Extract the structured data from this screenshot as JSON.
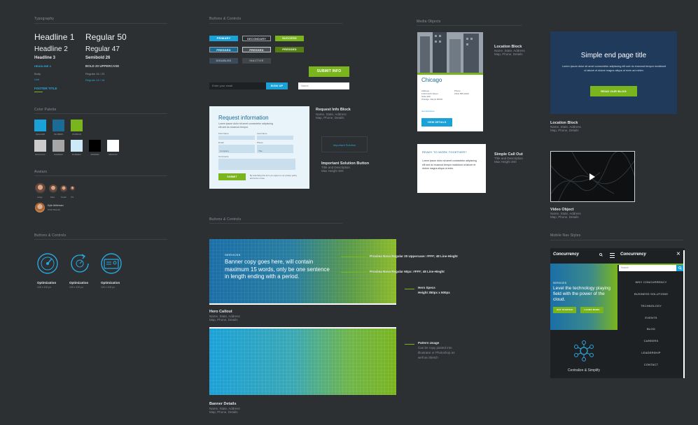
{
  "typography": {
    "section": "Typography",
    "h1": "Headline 1",
    "h2": "Headline 2",
    "h3": "Headline 3",
    "h4": "HEADLINE 4",
    "body": "Body",
    "link": "Link",
    "footer": "FOOTER TITLE",
    "r50": "Regular 50",
    "r47": "Regular 47",
    "sb26": "Semibold 26",
    "bold20": "BOLD 20 UPPERCASE",
    "r16": "Regular 16 / 20",
    "r14": "Regular 14 / 18"
  },
  "palette": {
    "section": "Color Palette",
    "row1": [
      {
        "hex": "#1aa1d8",
        "label": "#1AA1D8"
      },
      {
        "hex": "#1c6b95",
        "label": "#1C6B95"
      },
      {
        "hex": "#7ab51d",
        "label": "#7AB51D"
      }
    ],
    "row2": [
      {
        "hex": "#cccccc",
        "label": "#CCCCCC"
      },
      {
        "hex": "#a6a6a6",
        "label": "#A6A6A6"
      },
      {
        "hex": "#cde8f7",
        "label": "#CDE8F7"
      },
      {
        "hex": "#000000",
        "label": "#000000"
      },
      {
        "hex": "#ffffff",
        "label": "#FFFFFF"
      }
    ]
  },
  "avatars": {
    "section": "Avatars",
    "labels": [
      "Large",
      "Med",
      "Small",
      "XS"
    ],
    "name": "Kyle Abbeman",
    "role": "Chief Director"
  },
  "icons": {
    "section": "Buttons & Controls",
    "items": [
      {
        "name": "Optimization",
        "size": "100 x 100 px"
      },
      {
        "name": "Optimization",
        "size": "100 x 100 px"
      },
      {
        "name": "Optimization",
        "size": "100 x 100 px"
      }
    ]
  },
  "controls": {
    "section": "Buttons & Controls",
    "primary": "PRIMARY",
    "secondary": "SECONDARY",
    "success": "SUCCESS",
    "pressed1": "PRESSED",
    "pressed2": "PRESSED",
    "pressed3": "PRESSED",
    "disabled": "DISABLED",
    "inactive": "INACTIVE",
    "submit": "SUBMIT INFO",
    "search_placeholder": "Enter your email",
    "search_btn": "SIGN UP",
    "text_placeholder": "Name"
  },
  "request": {
    "title": "Request information",
    "text": "Lorem ipsum dolor sit amet consectetur adipiscing elit sed do eiusmod tempor.",
    "fields": [
      "First Name",
      "Last Name",
      "Email",
      "Phone",
      "Company",
      "Title"
    ],
    "comment": "Comments",
    "submit": "SUBMIT",
    "fine": "By submitting this form you agree to our privacy policy and terms of use.",
    "label": "Request Info Block",
    "desc1": "Name, State, Address",
    "desc2": "Map, Phone, Details"
  },
  "solution": {
    "button": "Important Solution",
    "label": "Important Solution Button",
    "desc1": "Title and Description",
    "desc2": "Max Height 300"
  },
  "media": {
    "section": "Media Objects",
    "city": "Chicago",
    "addr_l": [
      "Address",
      "1234 North Street",
      "Suite 200",
      "Chicago, Illinois 60601"
    ],
    "addr_r": [
      "Phone",
      "(312) 555-0100"
    ],
    "link": "Get directions",
    "btn": "VIEW DETAILS",
    "loc_label": "Location Block",
    "loc_desc1": "Name, State, Address",
    "loc_desc2": "Map, Phone, Details",
    "callout_title": "READY TO WORK TOGETHER?",
    "callout_text": "Lorem ipsum dolor sit amet consectetur adipiscing elit sed do eiusmod tempor incididunt ut labore et dolore magna aliqua ut enim.",
    "callout_label": "Simple Call Out",
    "callout_desc1": "Title and Description",
    "callout_desc2": "Max Height 300"
  },
  "endpage": {
    "title": "Simple end page title",
    "text": "Lorem ipsum dolor sit amet consectetur adipiscing elit sed do eiusmod tempor incididunt ut labore et dolore magna aliqua ut enim ad minim.",
    "btn": "READ OUR BLOG",
    "label": "Location Block",
    "desc1": "Name, State, Address",
    "desc2": "Map, Phone, Details"
  },
  "video": {
    "label": "Video Object",
    "desc1": "Name, State, Address",
    "desc2": "Map, Phone, Details"
  },
  "hero": {
    "section": "Buttons & Controls",
    "eyebrow": "SERVICES",
    "copy": "Banner copy goes here, will contain maximum 15 words, only be one sentence in length ending with a period.",
    "note1": "Proxima Nova Regular 20 Uppercase: #FFF; 48 Line-Hieght",
    "note2": "Proxima Nova Regular 60px: #FFF; 48 Line-Hieght",
    "specs_title": "Hero Specs",
    "specs": "Height 350px x 600px",
    "label": "Hero Callout",
    "desc1": "Name, State, Address",
    "desc2": "Map, Phone, Details"
  },
  "pattern": {
    "title": "Pattern Usage",
    "desc": [
      "Can be copy  pasted into",
      "Illustrator or Photoshop as",
      "well as Sketch"
    ],
    "label": "Banner Details",
    "desc1": "Name, State, Address",
    "desc2": "Map, Phone, Details"
  },
  "mobile": {
    "section": "Mobile Nav Styles",
    "logo": "Concurrency",
    "eyebrow": "SERVICES",
    "headline": "Level the technology playing field with the power of the cloud.",
    "btn1": "GET STARTED",
    "btn2": "LEARN MORE",
    "feature": "Centralize & Simplify",
    "search_placeholder": "Search",
    "nav": [
      "WHY CONCURRENCY",
      "BUSINESS SOLUTIONS",
      "TECHNOLOGY",
      "EVENTS",
      "BLOG",
      "CAREERS",
      "LEADERSHIP",
      "CONTACT"
    ]
  }
}
